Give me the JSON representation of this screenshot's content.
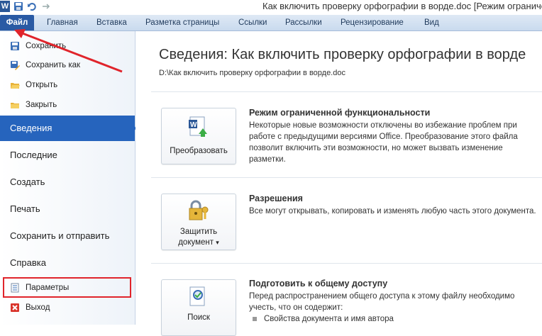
{
  "window": {
    "title": "Как включить проверку орфографии в ворде.doc [Режим ограниченно",
    "app_logo": "W"
  },
  "ribbon_tabs": [
    "Файл",
    "Главная",
    "Вставка",
    "Разметка страницы",
    "Ссылки",
    "Рассылки",
    "Рецензирование",
    "Вид"
  ],
  "backstage": {
    "commands": {
      "save": "Сохранить",
      "save_as": "Сохранить как",
      "open": "Открыть",
      "close": "Закрыть"
    },
    "nav": {
      "info": "Сведения",
      "recent": "Последние",
      "new": "Создать",
      "print": "Печать",
      "save_send": "Сохранить и отправить",
      "help": "Справка"
    },
    "options": "Параметры",
    "exit": "Выход"
  },
  "info": {
    "title": "Сведения: Как включить проверку орфографии в ворде",
    "path": "D:\\Как включить проверку орфографии в ворде.doc",
    "sections": [
      {
        "button": "Преобразовать",
        "heading": "Режим ограниченной функциональности",
        "text": "Некоторые новые возможности отключены во избежание проблем при работе с предыдущими версиями Office. Преобразование этого файла позволит включить эти возможности, но может вызвать изменение разметки."
      },
      {
        "button_line1": "Защитить",
        "button_line2": "документ",
        "button_arrow": "▾",
        "heading": "Разрешения",
        "text": "Все могут открывать, копировать и изменять любую часть этого документа."
      },
      {
        "button": "Поиск",
        "heading": "Подготовить к общему доступу",
        "text": "Перед распространением общего доступа к этому файлу необходимо учесть, что он содержит:",
        "bullet": "Свойства документа и имя автора"
      }
    ]
  },
  "colors": {
    "selected_nav": "#2664bd",
    "file_tab": "#2a5aa4",
    "annotation": "#e0242b"
  },
  "icons": [
    "word-logo-icon",
    "save-icon",
    "undo-icon",
    "redo-icon",
    "save-as-icon",
    "open-folder-icon",
    "close-folder-icon",
    "options-icon",
    "exit-icon",
    "convert-icon",
    "protect-icon",
    "inspect-icon"
  ]
}
